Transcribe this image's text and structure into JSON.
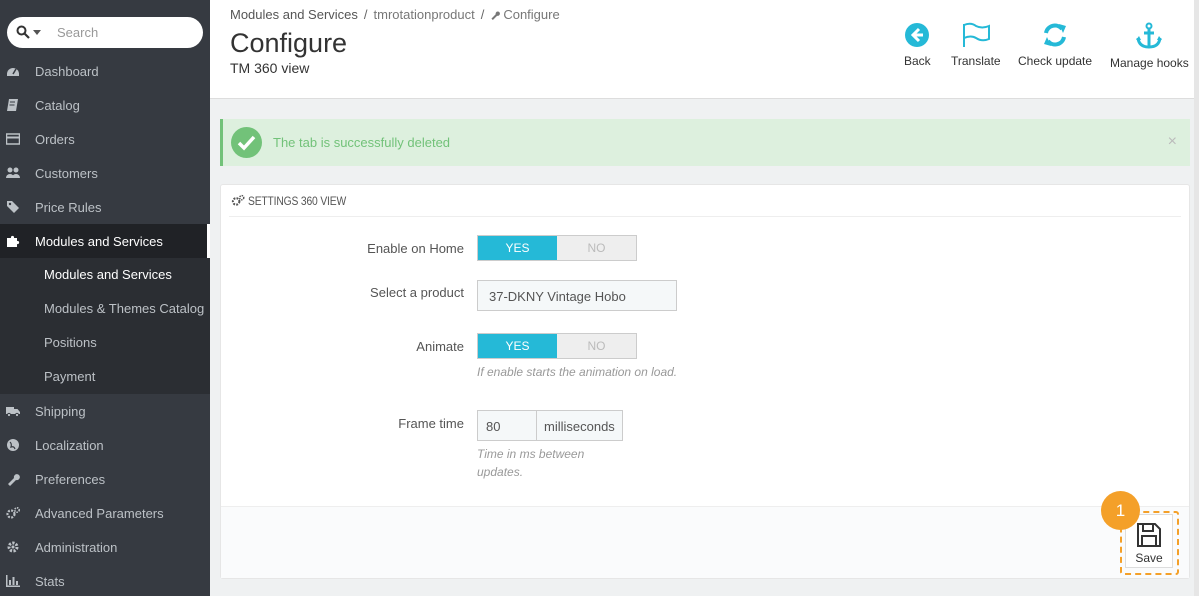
{
  "sidebar": {
    "search_placeholder": "Search",
    "items": [
      {
        "label": "Dashboard",
        "icon": "dashboard-icon"
      },
      {
        "label": "Catalog",
        "icon": "book-icon"
      },
      {
        "label": "Orders",
        "icon": "credit-card-icon"
      },
      {
        "label": "Customers",
        "icon": "users-icon"
      },
      {
        "label": "Price Rules",
        "icon": "tags-icon"
      },
      {
        "label": "Modules and Services",
        "icon": "puzzle-icon",
        "active": true
      }
    ],
    "subitems": [
      {
        "label": "Modules and Services",
        "current": true
      },
      {
        "label": "Modules & Themes Catalog"
      },
      {
        "label": "Positions"
      },
      {
        "label": "Payment"
      }
    ],
    "items_after": [
      {
        "label": "Shipping",
        "icon": "truck-icon"
      },
      {
        "label": "Localization",
        "icon": "globe-icon"
      },
      {
        "label": "Preferences",
        "icon": "wrench-icon"
      },
      {
        "label": "Advanced Parameters",
        "icon": "cogs-icon"
      },
      {
        "label": "Administration",
        "icon": "gear-icon"
      },
      {
        "label": "Stats",
        "icon": "bar-chart-icon"
      }
    ]
  },
  "header": {
    "breadcrumb": [
      "Modules and Services",
      "tmrotationproduct",
      "Configure"
    ],
    "title": "Configure",
    "subtitle": "TM 360 view",
    "toolbar": {
      "back": "Back",
      "translate": "Translate",
      "check_update": "Check update",
      "manage_hooks": "Manage hooks"
    }
  },
  "alert": {
    "text": "The tab is successfully deleted",
    "close": "×"
  },
  "panel": {
    "heading": "SETTINGS 360 VIEW",
    "enable_home": {
      "label": "Enable on Home",
      "yes": "YES",
      "no": "NO"
    },
    "product": {
      "label": "Select a product",
      "value": "37-DKNY Vintage Hobo"
    },
    "animate": {
      "label": "Animate",
      "yes": "YES",
      "no": "NO",
      "help": "If enable starts the animation on load."
    },
    "frame_time": {
      "label": "Frame time",
      "value": "80",
      "unit": "milliseconds",
      "help_line1": "Time in ms between",
      "help_line2": "updates."
    },
    "save": "Save"
  },
  "step_badge": "1",
  "colors": {
    "accent": "#25b9d7",
    "success": "#72c279",
    "highlight": "#f4a029",
    "sidebar_bg": "#363a41"
  }
}
